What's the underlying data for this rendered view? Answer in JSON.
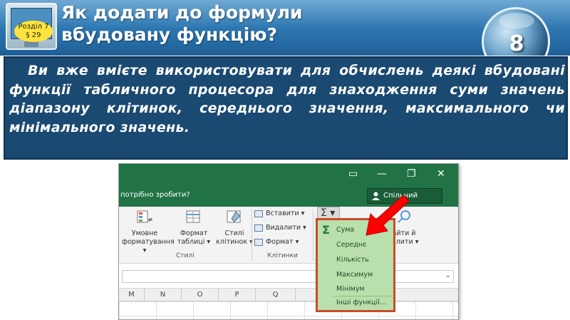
{
  "header": {
    "badge_line1": "Розділ 7",
    "badge_line2": "§ 29",
    "title_line1": "Як додати до формули",
    "title_line2": "вбудовану функцію?",
    "grade": "8"
  },
  "panel": {
    "text": "Ви вже вмієте використовувати для обчислень деякі вбудовані функції табличного процесора для знаходження суми значень діапазону клітинок, середнього значення, максимального чи мінімального значень."
  },
  "excel": {
    "tell_me": "потрібно зробити?",
    "share_label": "Спільний доступ",
    "ribbon": {
      "conditional_format": [
        "Умовне",
        "форматування ▾"
      ],
      "format_table": [
        "Формат",
        "таблиці ▾"
      ],
      "cell_styles": [
        "Стилі",
        "клітинок ▾"
      ],
      "styles_group": "Стилі",
      "insert": "Вставити ▾",
      "delete": "Видалити ▾",
      "format": "Формат ▾",
      "cells_group": "Клітинки",
      "sigma": "Σ ▾",
      "find_select": [
        "айти й",
        "ділити ▾"
      ]
    },
    "columns": [
      "M",
      "N",
      "O",
      "P",
      "Q"
    ],
    "autosum_menu": {
      "items": [
        "Сума",
        "Середнє",
        "Кількість",
        "Максимум",
        "Мінімум"
      ],
      "more": "Інші функції..."
    }
  },
  "colors": {
    "header_blue": "#2a73ad",
    "panel_navy": "#1a4971",
    "excel_green": "#217346",
    "menu_green": "#b9dfad",
    "highlight_red": "#c94b25",
    "badge_yellow": "#ffe43d"
  }
}
